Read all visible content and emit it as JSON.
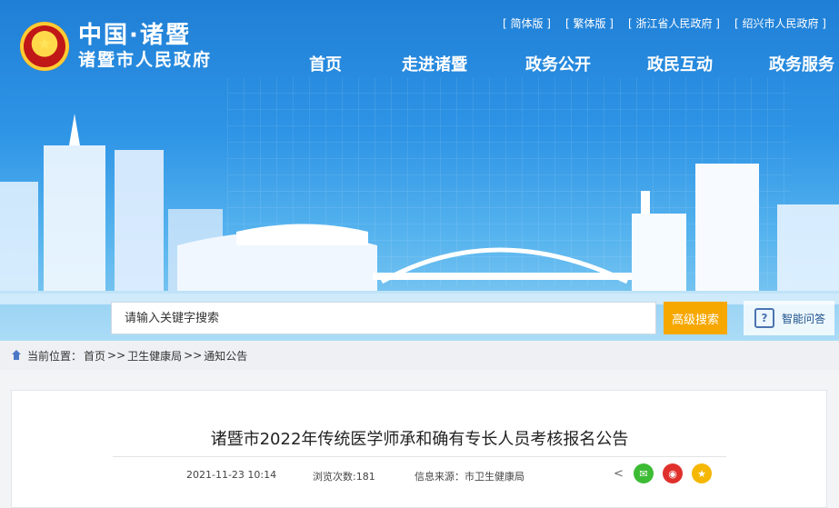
{
  "top_links": [
    "[ 简体版 ]",
    "[ 繁体版 ]",
    "[ 浙江省人民政府 ]",
    "[ 绍兴市人民政府 ]"
  ],
  "logo": {
    "cn": "中国·诸暨",
    "sub": "诸暨市人民政府"
  },
  "nav": [
    "首页",
    "走进诸暨",
    "政务公开",
    "政民互动",
    "政务服务"
  ],
  "search": {
    "placeholder": "请输入关键字搜索",
    "advanced_label": "高级搜索",
    "qa_label": "智能问答"
  },
  "breadcrumb": {
    "prefix": "当前位置：",
    "home": "首页",
    "sep": ">>",
    "dept": "卫生健康局",
    "section": "通知公告"
  },
  "article": {
    "title": "诸暨市2022年传统医学师承和确有专长人员考核报名公告",
    "date": "2021-11-23 10:14",
    "views": "浏览次数:181",
    "source": "信息来源：市卫生健康局"
  },
  "share_icons": [
    "share-icon",
    "wechat-icon",
    "weibo-icon",
    "favorite-icon"
  ],
  "colors": {
    "accent_orange": "#f6a700",
    "wechat": "#3dbb35",
    "weibo": "#e0302c",
    "favorite": "#f5b700",
    "sky": "#2f95e6"
  }
}
